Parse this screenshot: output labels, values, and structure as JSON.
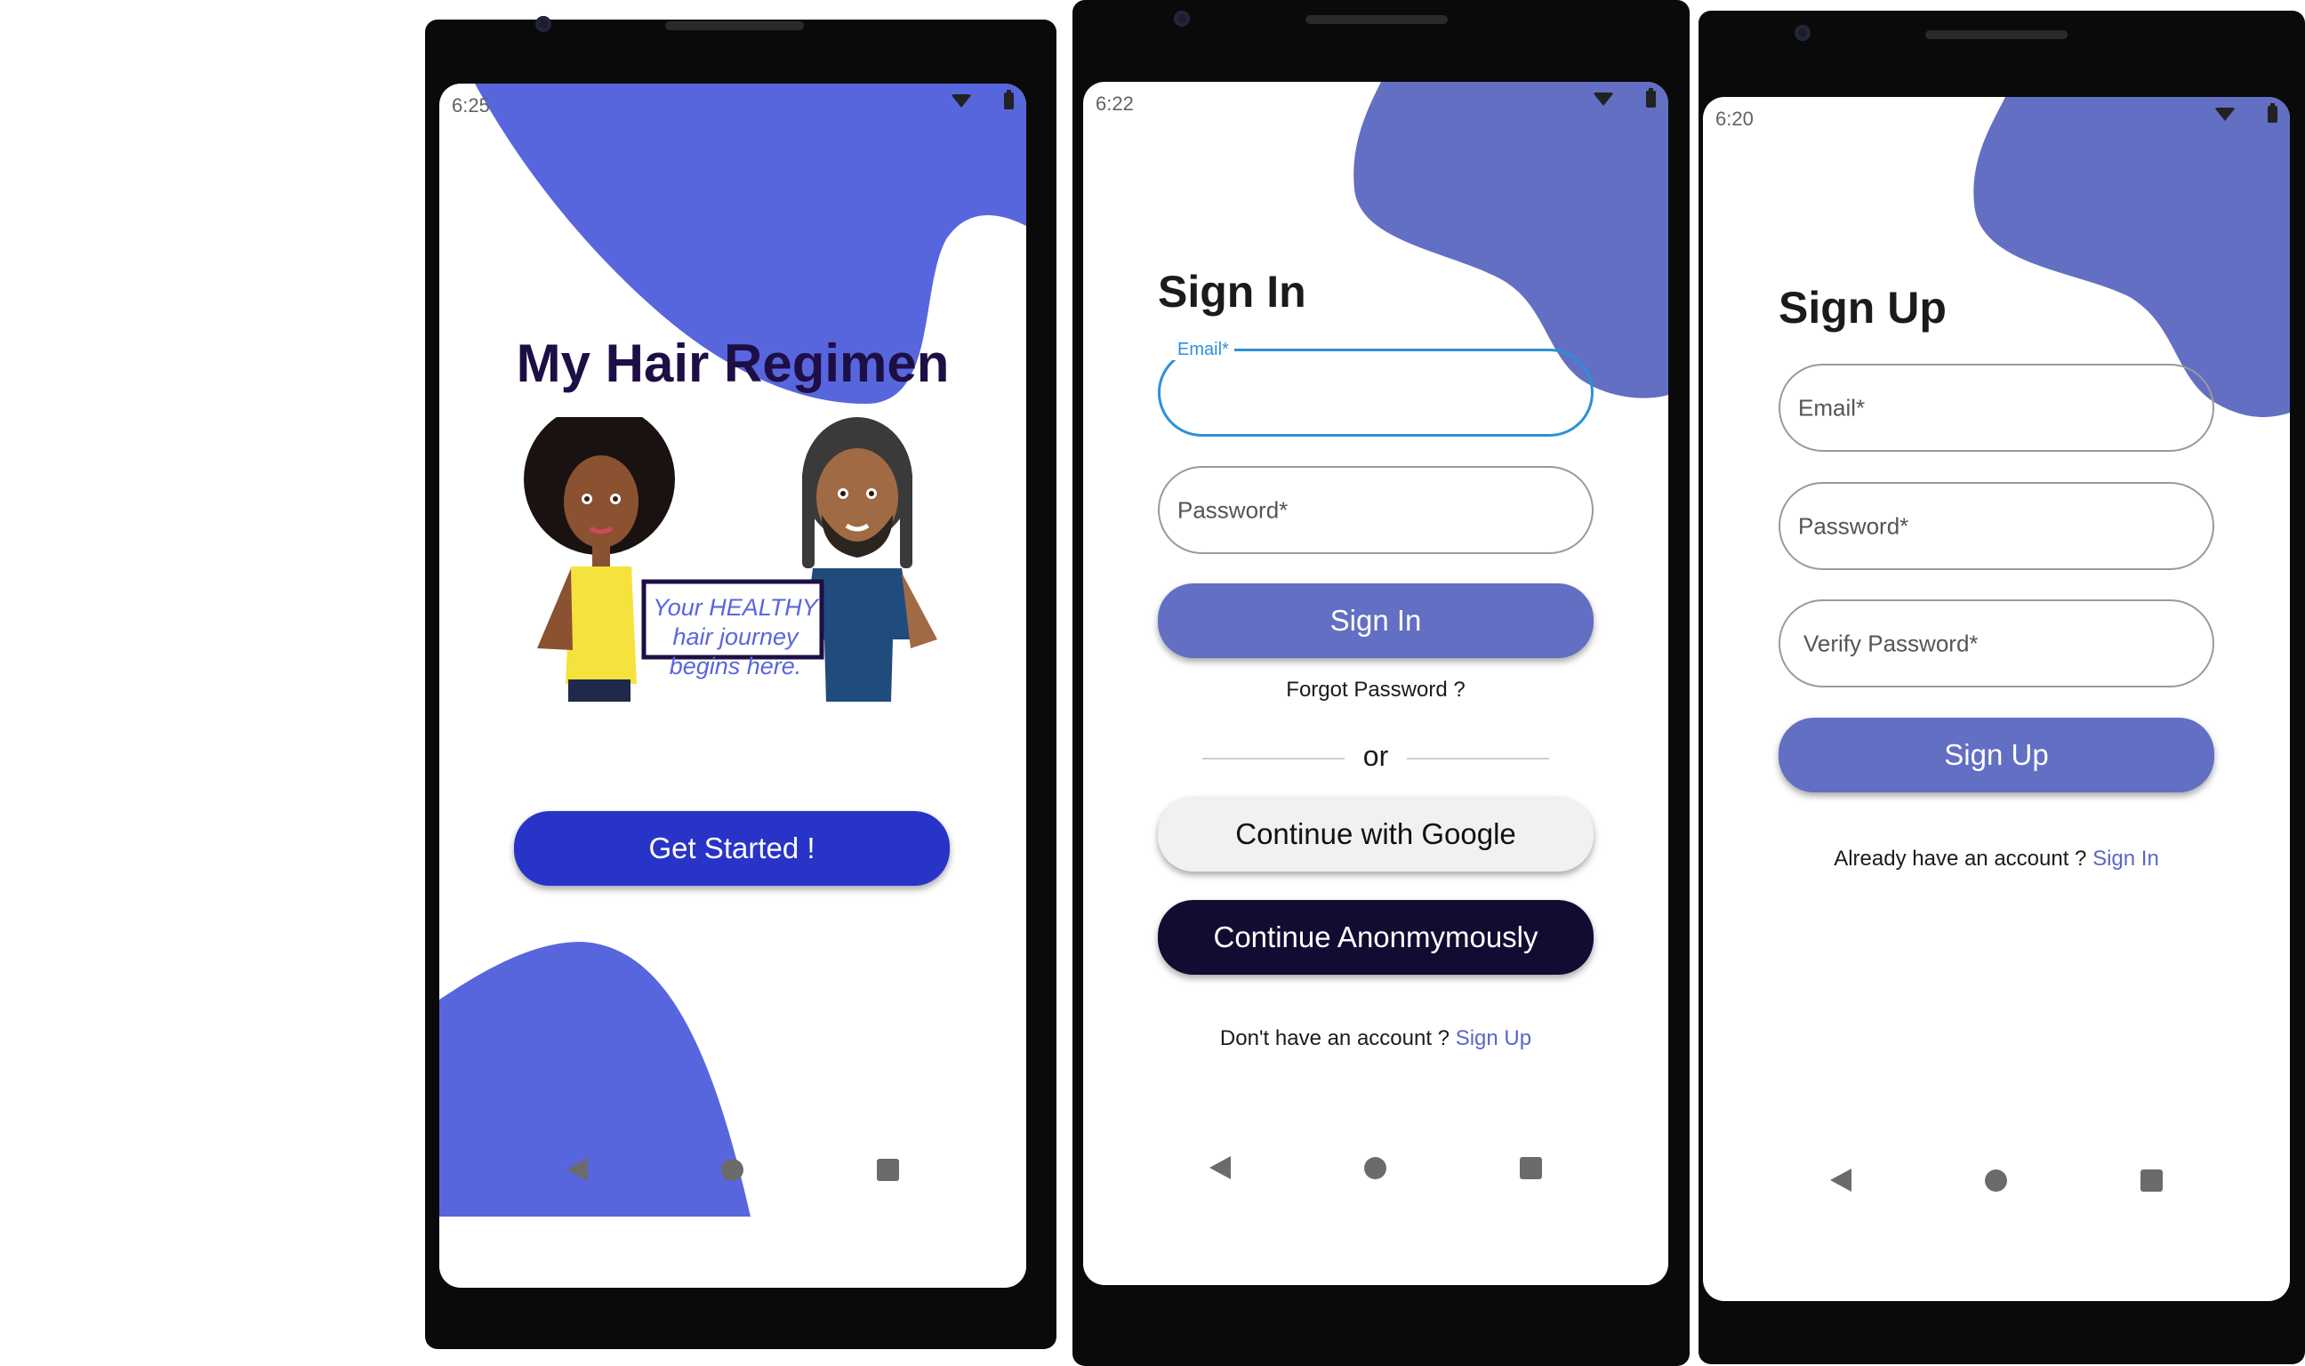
{
  "colors": {
    "accent_blue": "#5866de",
    "accent_blue_alt": "#626fc2",
    "primary_button": "#2834c8",
    "dark_button": "#140b33",
    "google_button": "#f1f1f1",
    "title_dark": "#1d0f45",
    "link": "#5a67c8",
    "focus_blue": "#2e8fd8"
  },
  "screen1": {
    "status_time": "6:25",
    "app_title": "My Hair Regimen",
    "sign_text": "Your HEALTHY hair journey begins here.",
    "get_started_label": "Get Started !"
  },
  "screen2": {
    "status_time": "6:22",
    "title": "Sign In",
    "email_label": "Email*",
    "password_label": "Password*",
    "sign_in_label": "Sign In",
    "forgot_label": "Forgot Password ?",
    "or_label": "or",
    "google_label": "Continue with Google",
    "anon_label": "Continue Anonmymously",
    "no_account_text": "Don't have an account ?",
    "sign_up_link": "Sign Up"
  },
  "screen3": {
    "status_time": "6:20",
    "title": "Sign Up",
    "email_label": "Email*",
    "password_label": "Password*",
    "verify_label": "Verify Password*",
    "sign_up_label": "Sign Up",
    "have_account_text": "Already have an account ?",
    "sign_in_link": "Sign In"
  },
  "icons": {
    "status": [
      "wifi-icon",
      "battery-icon"
    ],
    "navigation": [
      "back-icon",
      "home-icon",
      "recents-icon"
    ]
  }
}
